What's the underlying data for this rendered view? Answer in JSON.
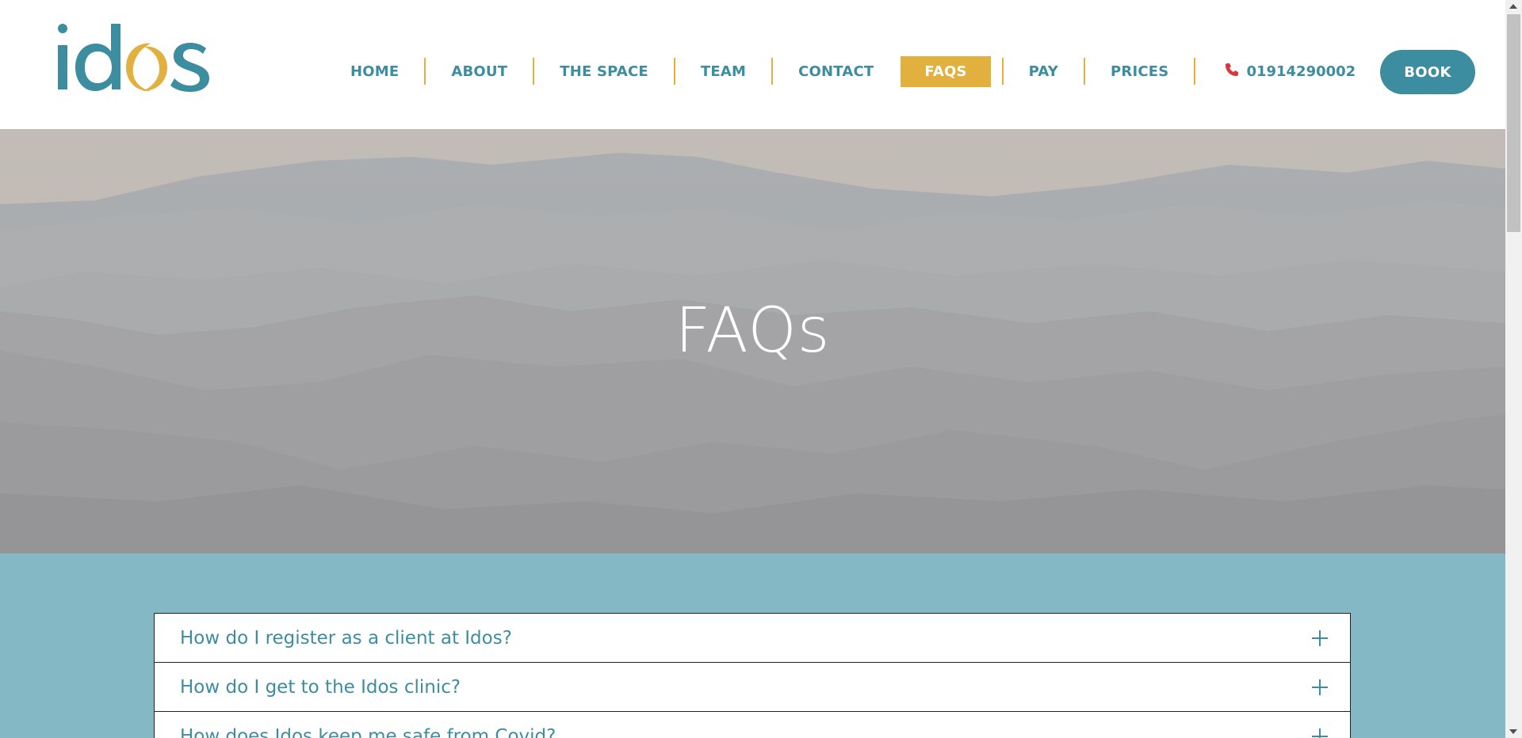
{
  "brand": {
    "logo_text": "idos",
    "primary_color": "#3d8da0",
    "accent_color": "#e1b03e"
  },
  "nav": {
    "items": [
      {
        "label": "HOME",
        "active": false
      },
      {
        "label": "ABOUT",
        "active": false
      },
      {
        "label": "THE SPACE",
        "active": false
      },
      {
        "label": "TEAM",
        "active": false
      },
      {
        "label": "CONTACT",
        "active": false
      },
      {
        "label": "FAQS",
        "active": true
      },
      {
        "label": "PAY",
        "active": false
      },
      {
        "label": "PRICES",
        "active": false
      }
    ],
    "phone": {
      "icon": "phone-icon",
      "number": "01914290002"
    },
    "book_label": "BOOK"
  },
  "hero": {
    "title": "FAQs"
  },
  "faq": {
    "questions": [
      "How do I register as a client at Idos?",
      "How do I get to the Idos clinic?",
      "How does Idos keep me safe from Covid?"
    ]
  }
}
